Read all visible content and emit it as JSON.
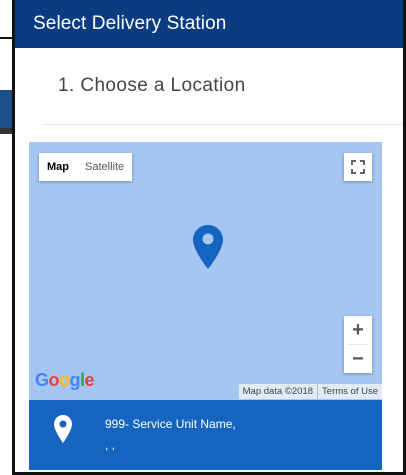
{
  "modal": {
    "title": "Select Delivery Station",
    "section_title": "1. Choose a Location"
  },
  "map": {
    "map_type_options": [
      "Map",
      "Satellite"
    ],
    "selected_map_type": "Map",
    "zoom_in_label": "+",
    "zoom_out_label": "−",
    "logo_letters": [
      "G",
      "o",
      "o",
      "g",
      "l",
      "e"
    ],
    "logo_colors": [
      "#4285F4",
      "#EA4335",
      "#FBBC05",
      "#4285F4",
      "#34A853",
      "#EA4335"
    ],
    "attribution": "Map data ©2018",
    "terms_label": "Terms of Use",
    "background_color": "#a5c5f3",
    "pin_color": "#1565c0"
  },
  "station": {
    "name": "999- Service Unit Name,",
    "address": ", ,"
  },
  "colors": {
    "header_bg": "#0b3c80",
    "panel_bg": "#1565c0"
  }
}
